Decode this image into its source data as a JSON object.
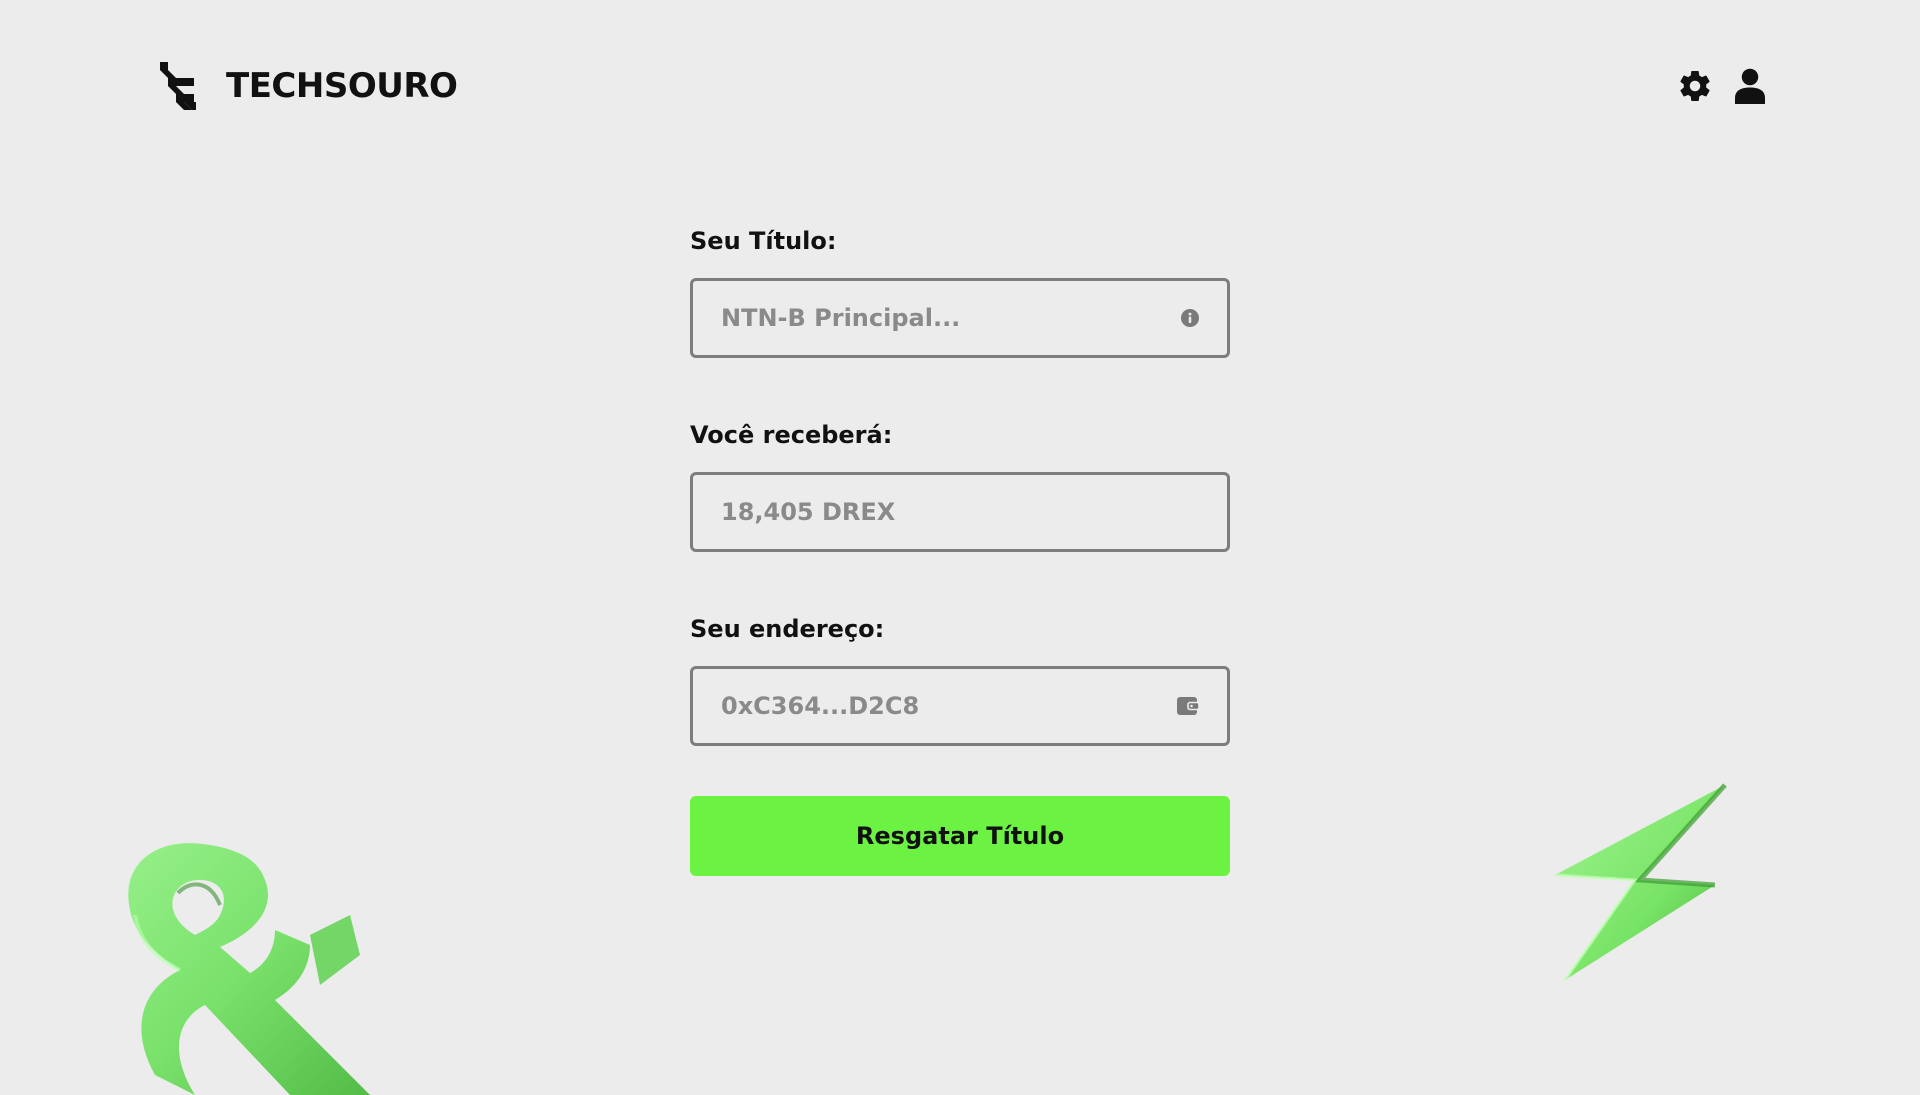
{
  "brand": {
    "name": "TECHSOURO",
    "logo_icon": "techsouro-logo-icon"
  },
  "header": {
    "settings_icon": "gear-icon",
    "profile_icon": "user-icon"
  },
  "form": {
    "title_field": {
      "label": "Seu Título:",
      "placeholder": "NTN-B Principal...",
      "icon": "info-icon"
    },
    "receive_field": {
      "label": "Você receberá:",
      "placeholder": "18,405 DREX"
    },
    "address_field": {
      "label": "Seu endereço:",
      "placeholder": "0xC364...D2C8",
      "icon": "wallet-icon"
    },
    "submit_label": "Resgatar Título"
  },
  "colors": {
    "background": "#ececec",
    "accent_green": "#6cf242",
    "text_dark": "#111111",
    "field_border": "#7d7d7d",
    "placeholder_gray": "#8a8a8a"
  }
}
